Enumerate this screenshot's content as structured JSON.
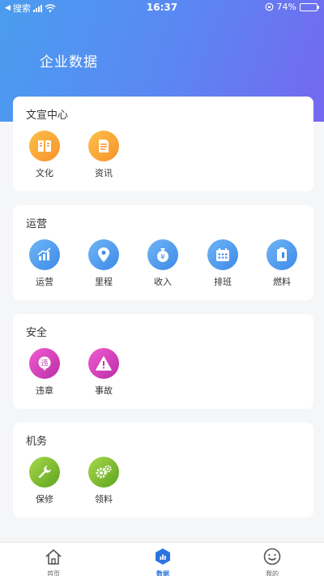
{
  "status": {
    "carrier": "搜索",
    "time": "16:37",
    "battery": "74%",
    "battery_level": 0.74
  },
  "header": {
    "title": "企业数据"
  },
  "sections": [
    {
      "title": "文宣中心",
      "items": [
        {
          "label": "文化",
          "icon": "book-icon"
        },
        {
          "label": "资讯",
          "icon": "document-icon"
        }
      ]
    },
    {
      "title": "运营",
      "items": [
        {
          "label": "运营",
          "icon": "trend-chart-icon"
        },
        {
          "label": "里程",
          "icon": "location-pin-icon"
        },
        {
          "label": "收入",
          "icon": "money-bag-icon"
        },
        {
          "label": "排班",
          "icon": "calendar-icon"
        },
        {
          "label": "燃料",
          "icon": "fuel-icon"
        }
      ]
    },
    {
      "title": "安全",
      "items": [
        {
          "label": "违章",
          "icon": "violation-badge-icon",
          "badge": "违"
        },
        {
          "label": "事故",
          "icon": "warning-icon"
        }
      ]
    },
    {
      "title": "机务",
      "items": [
        {
          "label": "保修",
          "icon": "wrench-icon"
        },
        {
          "label": "领料",
          "icon": "gears-icon"
        }
      ]
    }
  ],
  "tabbar": {
    "tabs": [
      {
        "label": "首页",
        "icon": "home-icon"
      },
      {
        "label": "数据",
        "icon": "data-hex-icon",
        "active": true
      },
      {
        "label": "我的",
        "icon": "smile-icon"
      }
    ]
  },
  "colors": {
    "accent": "#2b74e0",
    "header_start": "#4a9df0",
    "header_end": "#7468f0"
  }
}
